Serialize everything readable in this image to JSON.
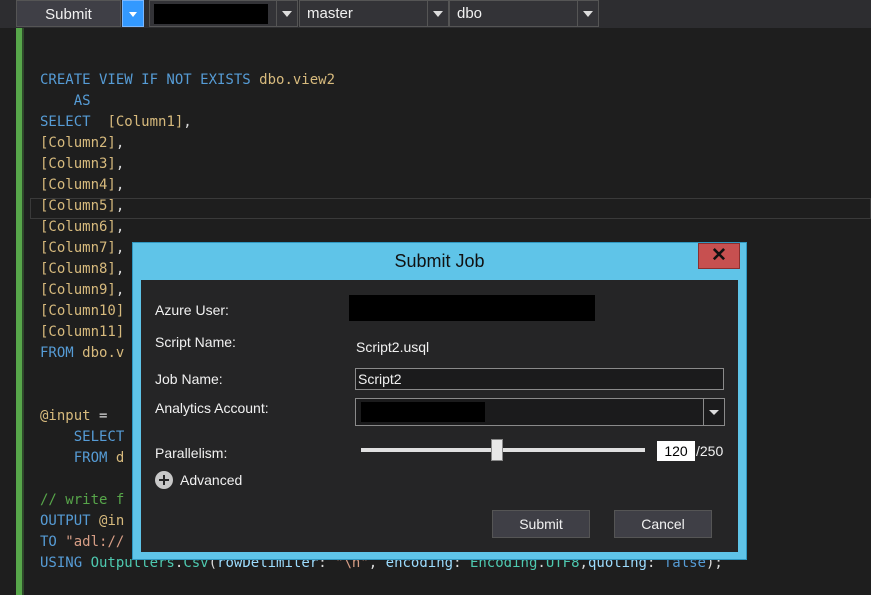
{
  "toolbar": {
    "submit_label": "Submit",
    "database": "master",
    "schema": "dbo"
  },
  "editor": {
    "lines": [
      [
        {
          "t": "CREATE VIEW IF NOT EXISTS ",
          "c": "kw"
        },
        {
          "t": "dbo.view2",
          "c": "id"
        }
      ],
      [
        {
          "t": "    AS",
          "c": "kw"
        }
      ],
      [
        {
          "t": "SELECT  ",
          "c": "kw"
        },
        {
          "t": "[Column1]",
          "c": "id"
        },
        {
          "t": ",",
          "c": ""
        }
      ],
      [
        {
          "t": "[Column2]",
          "c": "id"
        },
        {
          "t": ",",
          "c": ""
        }
      ],
      [
        {
          "t": "[Column3]",
          "c": "id"
        },
        {
          "t": ",",
          "c": ""
        }
      ],
      [
        {
          "t": "[Column4]",
          "c": "id"
        },
        {
          "t": ",",
          "c": ""
        }
      ],
      [
        {
          "t": "[Column5]",
          "c": "id"
        },
        {
          "t": ",",
          "c": ""
        }
      ],
      [
        {
          "t": "[Column6]",
          "c": "id"
        },
        {
          "t": ",",
          "c": ""
        }
      ],
      [
        {
          "t": "[Column7]",
          "c": "id"
        },
        {
          "t": ",",
          "c": ""
        }
      ],
      [
        {
          "t": "[Column8]",
          "c": "id"
        },
        {
          "t": ",",
          "c": ""
        }
      ],
      [
        {
          "t": "[Column9]",
          "c": "id"
        },
        {
          "t": ",",
          "c": ""
        }
      ],
      [
        {
          "t": "[Column10]",
          "c": "id"
        }
      ],
      [
        {
          "t": "[Column11]",
          "c": "id"
        }
      ],
      [
        {
          "t": "FROM ",
          "c": "kw"
        },
        {
          "t": "dbo.v",
          "c": "id"
        }
      ],
      [],
      [],
      [
        {
          "t": "@input",
          "c": "id"
        },
        {
          "t": " =",
          "c": ""
        }
      ],
      [
        {
          "t": "    SELECT",
          "c": "kw"
        }
      ],
      [
        {
          "t": "    FROM ",
          "c": "kw"
        },
        {
          "t": "d",
          "c": "id"
        }
      ],
      [],
      [
        {
          "t": "// write f",
          "c": "cm"
        }
      ],
      [
        {
          "t": "OUTPUT ",
          "c": "kw"
        },
        {
          "t": "@in",
          "c": "id"
        }
      ],
      [
        {
          "t": "TO ",
          "c": "kw"
        },
        {
          "t": "\"adl://",
          "c": "str"
        }
      ],
      [
        {
          "t": "USING ",
          "c": "kw"
        },
        {
          "t": "Outputters",
          "c": "ty"
        },
        {
          "t": ".",
          "c": ""
        },
        {
          "t": "Csv",
          "c": "ty"
        },
        {
          "t": "(",
          "c": ""
        },
        {
          "t": "rowDelimiter",
          "c": "pr"
        },
        {
          "t": ": ",
          "c": ""
        },
        {
          "t": "\"\\n\"",
          "c": "str"
        },
        {
          "t": ", ",
          "c": ""
        },
        {
          "t": "encoding",
          "c": "pr"
        },
        {
          "t": ": ",
          "c": ""
        },
        {
          "t": "Encoding",
          "c": "ty"
        },
        {
          "t": ".",
          "c": ""
        },
        {
          "t": "UTF8",
          "c": "ty"
        },
        {
          "t": ",",
          "c": ""
        },
        {
          "t": "quoting",
          "c": "pr"
        },
        {
          "t": ": ",
          "c": ""
        },
        {
          "t": "false",
          "c": "kw"
        },
        {
          "t": ");",
          "c": ""
        }
      ]
    ]
  },
  "dialog": {
    "title": "Submit Job",
    "close_glyph": "✕",
    "azure_user_label": "Azure User:",
    "script_name_label": "Script Name:",
    "script_name": "Script2.usql",
    "job_name_label": "Job Name:",
    "job_name": "Script2",
    "analytics_account_label": "Analytics Account:",
    "parallelism_label": "Parallelism:",
    "parallelism": "120",
    "parallelism_max": "/250",
    "parallelism_fraction": 0.48,
    "advanced_label": "Advanced",
    "submit_label": "Submit",
    "cancel_label": "Cancel"
  }
}
